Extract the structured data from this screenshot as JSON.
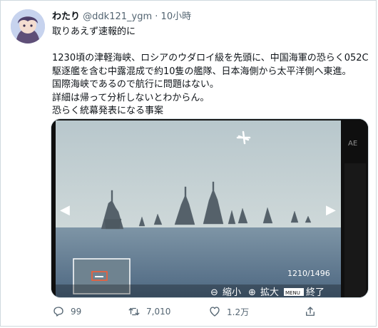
{
  "tweet": {
    "display_name": "わたり",
    "handle": "@ddk121_ygm",
    "separator": "·",
    "time": "10小時",
    "lines": [
      "取りあえず速報的に",
      "",
      "1230頃の津軽海峡、ロシアのウダロイ級を先頭に、中国海軍の恐らく052C",
      "駆逐艦を含む中露混成で約10隻の艦隊、日本海側から太平洋側へ東進。",
      "国際海峡であるので航行に問題はない。",
      "詳細は帰って分析しないとわからん。",
      "恐らく統幕発表になる事案"
    ]
  },
  "photo": {
    "frame_counter": "1210/1496",
    "bottom_labels": [
      "縮小",
      "拡大",
      "終了"
    ],
    "menu_badge": "MENU",
    "side_letter": "AE",
    "icons": [
      "airplane-icon",
      "left-arrow-icon",
      "right-arrow-icon",
      "zoom-out-icon",
      "zoom-in-icon",
      "menu-icon"
    ]
  },
  "actions": {
    "reply_count": "99",
    "retweet_count": "7,010",
    "like_count": "1.2万"
  },
  "icons": {
    "reply": "reply-icon",
    "retweet": "retweet-icon",
    "like": "heart-icon",
    "share": "share-icon"
  }
}
